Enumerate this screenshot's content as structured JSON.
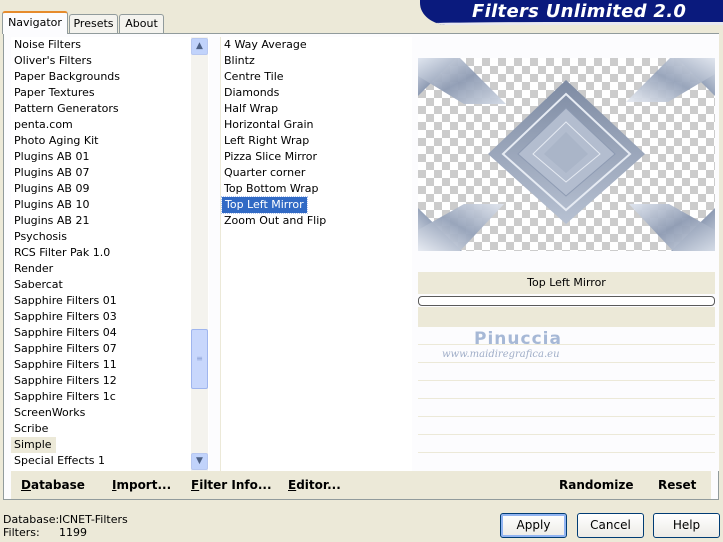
{
  "tabs": [
    {
      "label": "Navigator",
      "active": true
    },
    {
      "label": "Presets",
      "active": false
    },
    {
      "label": "About",
      "active": false
    }
  ],
  "banner": {
    "title": "Filters Unlimited 2.0"
  },
  "categories": {
    "items": [
      "Noise Filters",
      "Oliver's Filters",
      "Paper Backgrounds",
      "Paper Textures",
      "Pattern Generators",
      "penta.com",
      "Photo Aging Kit",
      "Plugins AB 01",
      "Plugins AB 07",
      "Plugins AB 09",
      "Plugins AB 10",
      "Plugins AB 21",
      "Psychosis",
      "RCS Filter Pak 1.0",
      "Render",
      "Sabercat",
      "Sapphire Filters 01",
      "Sapphire Filters 03",
      "Sapphire Filters 04",
      "Sapphire Filters 07",
      "Sapphire Filters 11",
      "Sapphire Filters 12",
      "Sapphire Filters 1c",
      "ScreenWorks",
      "Scribe",
      "Simple",
      "Special Effects 1"
    ],
    "selected": "Simple"
  },
  "filters": {
    "items": [
      "4 Way Average",
      "Blintz",
      "Centre Tile",
      "Diamonds",
      "Half Wrap",
      "Horizontal Grain",
      "Left Right Wrap",
      "Pizza Slice Mirror",
      "Quarter corner",
      "Top Bottom Wrap",
      "Top Left Mirror",
      "Zoom Out and Flip"
    ],
    "selected": "Top Left Mirror"
  },
  "preview": {
    "filter_name": "Top Left Mirror",
    "progress": 0,
    "watermark_name": "Pinuccia",
    "watermark_url": "www.maidiregrafica.eu"
  },
  "bottom_bar": {
    "database": "Database",
    "import": "Import...",
    "filter_info": "Filter Info...",
    "editor": "Editor...",
    "randomize": "Randomize",
    "reset": "Reset"
  },
  "status": {
    "database_label": "Database:",
    "database_value": "ICNET-Filters",
    "filters_label": "Filters:",
    "filters_value": "1199"
  },
  "buttons": {
    "apply": "Apply",
    "cancel": "Cancel",
    "help": "Help"
  },
  "colors": {
    "selection": "#316ac5",
    "banner": "#0a1a7d",
    "tab_accent": "#e68b2c"
  }
}
